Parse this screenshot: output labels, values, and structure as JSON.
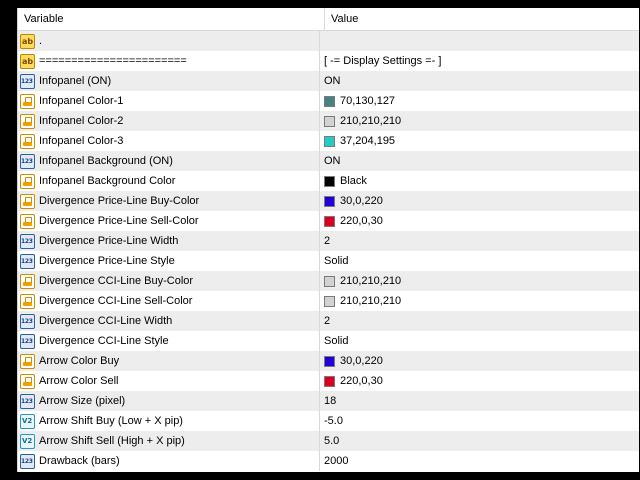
{
  "columns": {
    "variable": "Variable",
    "value": "Value"
  },
  "rows": [
    {
      "icon": "ab",
      "name": ".",
      "value": ""
    },
    {
      "icon": "ab",
      "name": "=======================",
      "value": "[ -= Display Settings =- ]"
    },
    {
      "icon": "num",
      "name": "Infopanel (ON)",
      "value": "ON"
    },
    {
      "icon": "col",
      "name": "Infopanel Color-1",
      "value": "70,130,127",
      "swatch": "#46827f"
    },
    {
      "icon": "col",
      "name": "Infopanel Color-2",
      "value": "210,210,210",
      "swatch": "#d2d2d2"
    },
    {
      "icon": "col",
      "name": "Infopanel Color-3",
      "value": "37,204,195",
      "swatch": "#25ccc3"
    },
    {
      "icon": "num",
      "name": "Infopanel Background (ON)",
      "value": "ON"
    },
    {
      "icon": "col",
      "name": "Infopanel Background Color",
      "value": "Black",
      "swatch": "#000000"
    },
    {
      "icon": "col",
      "name": "Divergence Price-Line Buy-Color",
      "value": "30,0,220",
      "swatch": "#1e00dc"
    },
    {
      "icon": "col",
      "name": "Divergence Price-Line Sell-Color",
      "value": "220,0,30",
      "swatch": "#dc001e"
    },
    {
      "icon": "num",
      "name": "Divergence Price-Line Width",
      "value": "2"
    },
    {
      "icon": "num",
      "name": "Divergence Price-Line Style",
      "value": "Solid"
    },
    {
      "icon": "col",
      "name": "Divergence CCI-Line Buy-Color",
      "value": "210,210,210",
      "swatch": "#d2d2d2"
    },
    {
      "icon": "col",
      "name": "Divergence CCI-Line Sell-Color",
      "value": "210,210,210",
      "swatch": "#d2d2d2"
    },
    {
      "icon": "num",
      "name": "Divergence CCI-Line Width",
      "value": "2"
    },
    {
      "icon": "num",
      "name": "Divergence CCI-Line Style",
      "value": "Solid"
    },
    {
      "icon": "col",
      "name": "Arrow Color Buy",
      "value": "30,0,220",
      "swatch": "#1e00dc"
    },
    {
      "icon": "col",
      "name": "Arrow Color Sell",
      "value": "220,0,30",
      "swatch": "#dc001e"
    },
    {
      "icon": "num",
      "name": "Arrow Size (pixel)",
      "value": "18"
    },
    {
      "icon": "dbl",
      "name": "Arrow Shift Buy (Low + X pip)",
      "value": "-5.0"
    },
    {
      "icon": "dbl",
      "name": "Arrow Shift Sell (High + X pip)",
      "value": "5.0"
    },
    {
      "icon": "num",
      "name": "Drawback (bars)",
      "value": "2000"
    }
  ],
  "colors": {
    "row_odd": "#ededed",
    "row_even": "#ffffff",
    "background": "#000000"
  }
}
